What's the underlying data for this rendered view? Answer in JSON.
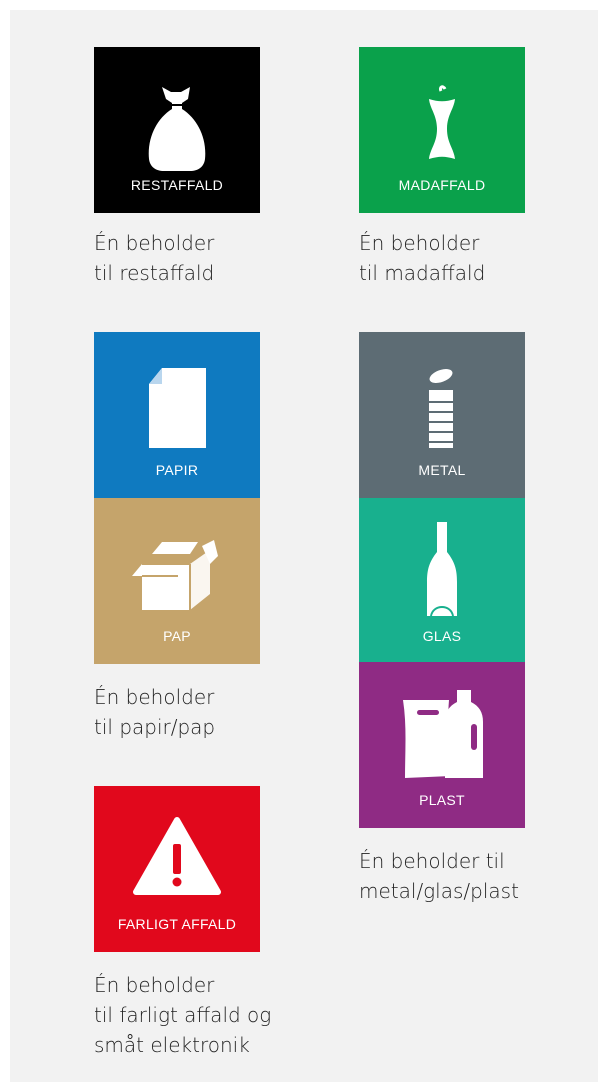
{
  "colors": {
    "restaffald": "#000000",
    "madaffald": "#0aa14b",
    "papir": "#0f7ac0",
    "pap": "#c5a46b",
    "metal": "#5d6c74",
    "glas": "#18b08e",
    "plast": "#8f2b84",
    "farligt": "#e1081c"
  },
  "tiles": {
    "restaffald": {
      "label": "RESTAFFALD",
      "icon": "trash-bag-icon"
    },
    "madaffald": {
      "label": "MADAFFALD",
      "icon": "apple-core-icon"
    },
    "papir": {
      "label": "PAPIR",
      "icon": "paper-sheet-icon"
    },
    "pap": {
      "label": "PAP",
      "icon": "cardboard-box-icon"
    },
    "metal": {
      "label": "METAL",
      "icon": "tin-can-icon"
    },
    "glas": {
      "label": "GLAS",
      "icon": "bottle-icon"
    },
    "plast": {
      "label": "PLAST",
      "icon": "plastic-bag-bottle-icon"
    },
    "farligt": {
      "label": "FARLIGT AFFALD",
      "icon": "warning-icon"
    }
  },
  "captions": {
    "restaffald": [
      "Én beholder",
      "til restaffald"
    ],
    "madaffald": [
      "Én beholder",
      "til madaffald"
    ],
    "papir_pap": [
      "Én beholder",
      "til papir/pap"
    ],
    "metal_glas_plast": [
      "Én beholder til",
      "metal/glas/plast"
    ],
    "farligt": [
      "Én beholder",
      "til farligt affald og",
      "småt elektronik"
    ]
  }
}
